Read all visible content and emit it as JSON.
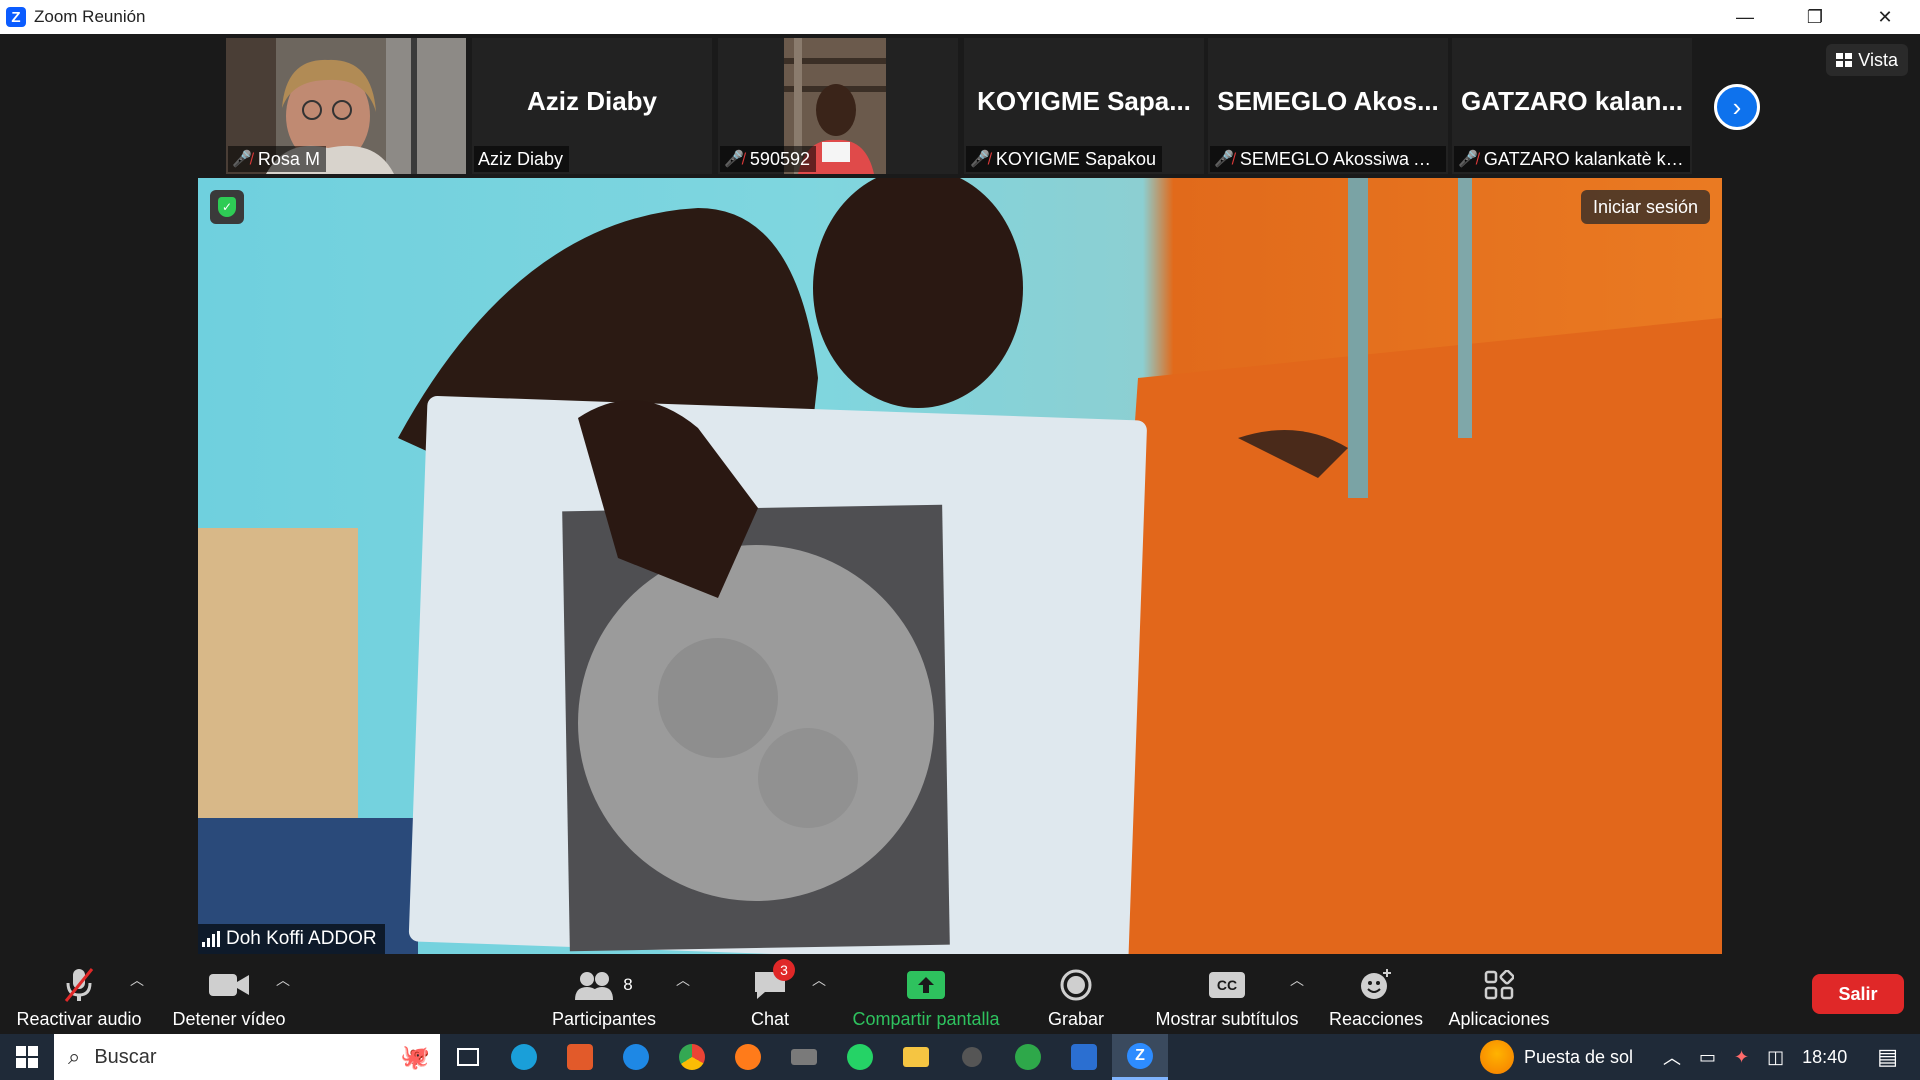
{
  "window": {
    "title": "Zoom Reunión",
    "controls": [
      "—",
      "❐",
      "✕"
    ]
  },
  "strip": {
    "tiles": [
      {
        "label": "Rosa M",
        "muted": true,
        "has_video": true
      },
      {
        "big_name": "Aziz Diaby",
        "label": "Aziz Diaby",
        "muted": false,
        "has_video": false
      },
      {
        "label": "590592",
        "muted": true,
        "has_video": true
      },
      {
        "big_name": "KOYIGME  Sapa...",
        "label": "KOYIGME Sapakou",
        "muted": true,
        "has_video": false
      },
      {
        "big_name": "SEMEGLO  Akos...",
        "label": "SEMEGLO Akossiwa Ai...",
        "muted": true,
        "has_video": false
      },
      {
        "big_name": "GATZARO  kalan...",
        "label": "GATZARO kalankatè ke...",
        "muted": true,
        "has_video": false
      }
    ],
    "view_label": "Vista"
  },
  "main_video": {
    "signin_label": "Iniciar sesión",
    "speaker_name": "Doh Koffi ADDOR"
  },
  "toolbar": {
    "audio_label": "Reactivar audio",
    "video_label": "Detener vídeo",
    "participants_label": "Participantes",
    "participants_count": "8",
    "chat_label": "Chat",
    "chat_badge": "3",
    "share_label": "Compartir pantalla",
    "record_label": "Grabar",
    "captions_label": "Mostrar subtítulos",
    "captions_icon_text": "CC",
    "reactions_label": "Reacciones",
    "apps_label": "Aplicaciones",
    "leave_label": "Salir",
    "share_color": "#2ec25e",
    "leave_color": "#e02828"
  },
  "taskbar": {
    "search_placeholder": "Buscar",
    "weather": "Puesta de sol",
    "time": "18:40",
    "apps": [
      "task-view-icon",
      "edge-icon",
      "office-icon",
      "teamviewer-icon",
      "chrome-icon",
      "firefox-icon",
      "mail-icon",
      "whatsapp-icon",
      "file-explorer-icon",
      "game-icon",
      "refresh-app-icon",
      "outlook-icon",
      "zoom-icon"
    ]
  }
}
